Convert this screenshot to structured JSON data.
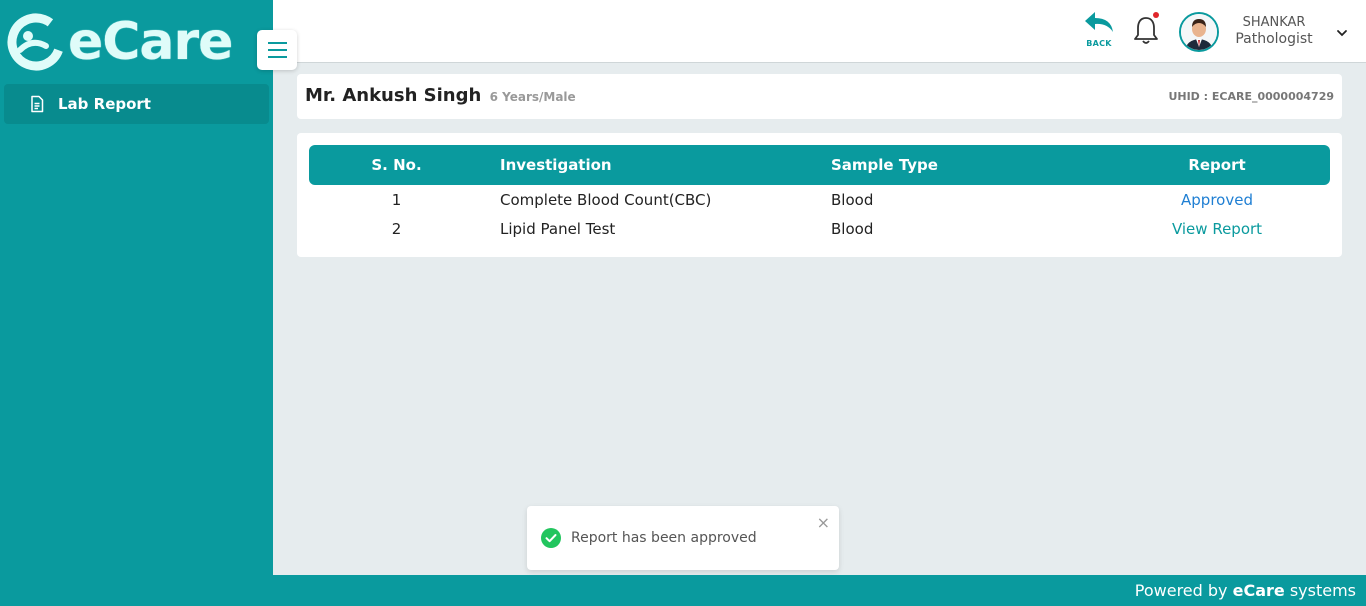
{
  "brand": {
    "logo_text": "eCare"
  },
  "sidebar": {
    "items": [
      {
        "label": "Lab Report"
      }
    ]
  },
  "header": {
    "back_label": "BACK",
    "user": {
      "name": "SHANKAR",
      "role": "Pathologist"
    }
  },
  "patient": {
    "name": "Mr. Ankush Singh",
    "meta": "6 Years/Male",
    "uhid": "UHID : ECARE_0000004729"
  },
  "table": {
    "headers": {
      "sno": "S. No.",
      "investigation": "Investigation",
      "sample_type": "Sample Type",
      "report": "Report"
    },
    "rows": [
      {
        "sno": "1",
        "investigation": "Complete Blood Count(CBC)",
        "sample_type": "Blood",
        "report": "Approved"
      },
      {
        "sno": "2",
        "investigation": "Lipid Panel Test",
        "sample_type": "Blood",
        "report": "View Report"
      }
    ]
  },
  "toast": {
    "message": "Report has been approved",
    "close": "×"
  },
  "footer": {
    "prefix": "Powered by ",
    "brand": "eCare",
    "suffix": " systems"
  },
  "colors": {
    "primary": "#0a9a9e",
    "link_blue": "#1f7fd3",
    "notification_dot": "#e0262b",
    "success": "#22c55e"
  }
}
